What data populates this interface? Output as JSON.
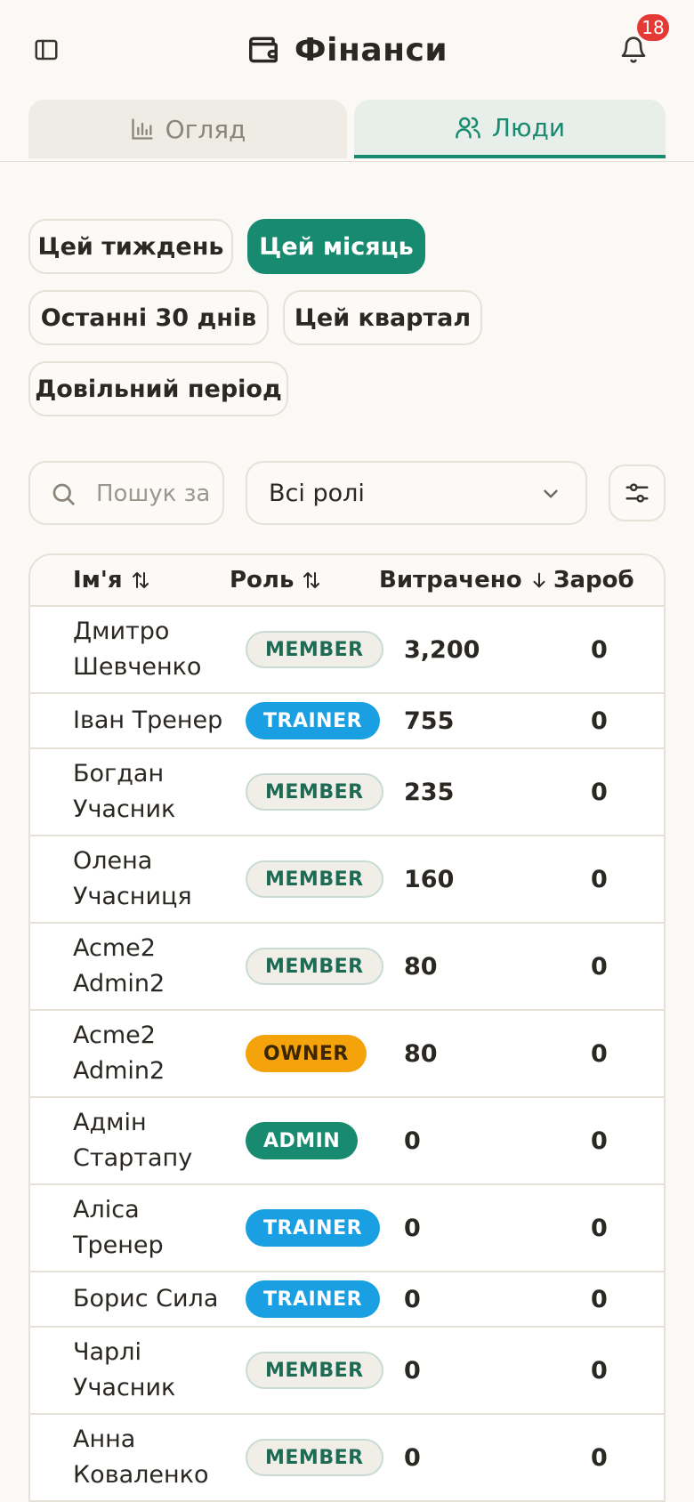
{
  "header": {
    "title": "Фінанси",
    "notification_count": "18"
  },
  "tabs": [
    {
      "label": "Огляд",
      "active": false
    },
    {
      "label": "Люди",
      "active": true
    }
  ],
  "periods": [
    {
      "label": "Цей тиждень",
      "active": false
    },
    {
      "label": "Цей місяць",
      "active": true
    },
    {
      "label": "Останні 30 днів",
      "active": false
    },
    {
      "label": "Цей квартал",
      "active": false
    },
    {
      "label": "Довільний період",
      "active": false
    }
  ],
  "filters": {
    "search_placeholder": "Пошук за",
    "role_selected": "Всі ролі"
  },
  "table": {
    "columns": {
      "name": "Ім'я",
      "role": "Роль",
      "spent": "Витрачено",
      "earned": "Зароб"
    },
    "rows": [
      {
        "name": "Дмитро Шевченко",
        "role": "MEMBER",
        "spent": "3,200",
        "earned": "0"
      },
      {
        "name": "Іван Тренер",
        "role": "TRAINER",
        "spent": "755",
        "earned": "0"
      },
      {
        "name": "Богдан Учасник",
        "role": "MEMBER",
        "spent": "235",
        "earned": "0"
      },
      {
        "name": "Олена Учасниця",
        "role": "MEMBER",
        "spent": "160",
        "earned": "0"
      },
      {
        "name": "Acme2 Admin2",
        "role": "MEMBER",
        "spent": "80",
        "earned": "0"
      },
      {
        "name": "Acme2 Admin2",
        "role": "OWNER",
        "spent": "80",
        "earned": "0"
      },
      {
        "name": "Адмін Стартапу",
        "role": "ADMIN",
        "spent": "0",
        "earned": "0"
      },
      {
        "name": "Аліса Тренер",
        "role": "TRAINER",
        "spent": "0",
        "earned": "0"
      },
      {
        "name": "Борис Сила",
        "role": "TRAINER",
        "spent": "0",
        "earned": "0"
      },
      {
        "name": "Чарлі Учасник",
        "role": "MEMBER",
        "spent": "0",
        "earned": "0"
      },
      {
        "name": "Анна Коваленко",
        "role": "MEMBER",
        "spent": "0",
        "earned": "0"
      }
    ]
  },
  "colors": {
    "accent": "#178a6f",
    "trainer": "#1a9fe3",
    "owner": "#f5a30b",
    "badge": "#e53935"
  },
  "icons": {
    "sidebar": "sidebar-toggle-icon",
    "brand": "wallet-icon",
    "notifications": "bell-icon",
    "overview_tab": "bar-chart-icon",
    "people_tab": "users-icon",
    "search": "search-icon",
    "dropdown": "chevron-down-icon",
    "filters": "sliders-icon",
    "sort": "sort-icon"
  }
}
